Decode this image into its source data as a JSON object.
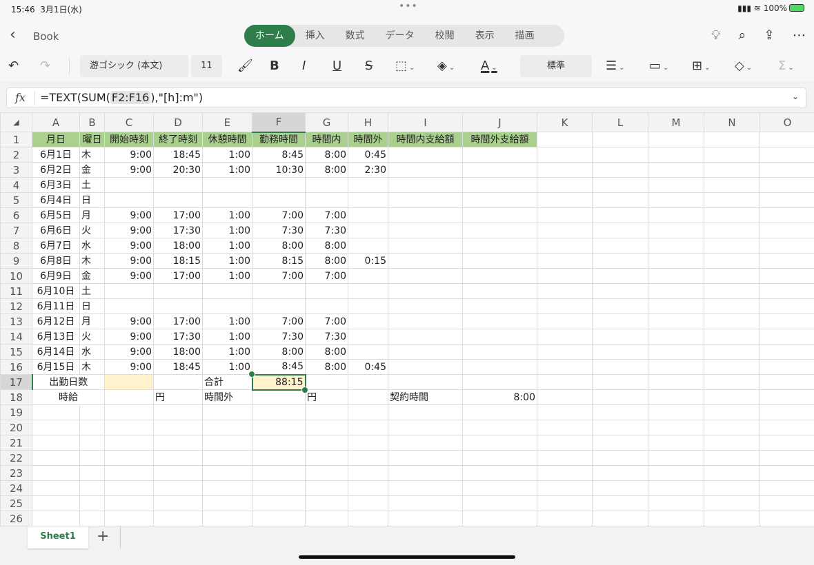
{
  "status": {
    "time": "15:46",
    "date": "3月1日(水)",
    "battery": "100%"
  },
  "nav": {
    "back": "Book",
    "tabs": [
      "ホーム",
      "挿入",
      "数式",
      "データ",
      "校閲",
      "表示",
      "描画"
    ],
    "active_tab": 0
  },
  "toolbar": {
    "font": "游ゴシック (本文)",
    "size": "11",
    "number_format": "標準"
  },
  "formula": {
    "prefix": "=TEXT(SUM(",
    "ref": "F2:F16",
    "suffix": "),\"[h]:m\")"
  },
  "columns": [
    "A",
    "B",
    "C",
    "D",
    "E",
    "F",
    "G",
    "H",
    "I",
    "J",
    "K",
    "L",
    "M",
    "N",
    "O"
  ],
  "selected": {
    "col": "F",
    "row": 17
  },
  "colors": {
    "accent": "#2e7d4a",
    "header_fill": "#a9d08e",
    "input_fill": "#fff2cc"
  },
  "rows": [
    [
      "月日",
      "曜日",
      "開始時刻",
      "終了時刻",
      "休憩時間",
      "勤務時間",
      "時間内",
      "時間外",
      "時間内支給額",
      "時間外支給額"
    ],
    [
      "6月1日",
      "木",
      "9:00",
      "18:45",
      "1:00",
      "8:45",
      "8:00",
      "0:45",
      "",
      ""
    ],
    [
      "6月2日",
      "金",
      "9:00",
      "20:30",
      "1:00",
      "10:30",
      "8:00",
      "2:30",
      "",
      ""
    ],
    [
      "6月3日",
      "土",
      "",
      "",
      "",
      "",
      "",
      "",
      "",
      ""
    ],
    [
      "6月4日",
      "日",
      "",
      "",
      "",
      "",
      "",
      "",
      "",
      ""
    ],
    [
      "6月5日",
      "月",
      "9:00",
      "17:00",
      "1:00",
      "7:00",
      "7:00",
      "",
      "",
      ""
    ],
    [
      "6月6日",
      "火",
      "9:00",
      "17:30",
      "1:00",
      "7:30",
      "7:30",
      "",
      "",
      ""
    ],
    [
      "6月7日",
      "水",
      "9:00",
      "18:00",
      "1:00",
      "8:00",
      "8:00",
      "",
      "",
      ""
    ],
    [
      "6月8日",
      "木",
      "9:00",
      "18:15",
      "1:00",
      "8:15",
      "8:00",
      "0:15",
      "",
      ""
    ],
    [
      "6月9日",
      "金",
      "9:00",
      "17:00",
      "1:00",
      "7:00",
      "7:00",
      "",
      "",
      ""
    ],
    [
      "6月10日",
      "土",
      "",
      "",
      "",
      "",
      "",
      "",
      "",
      ""
    ],
    [
      "6月11日",
      "日",
      "",
      "",
      "",
      "",
      "",
      "",
      "",
      ""
    ],
    [
      "6月12日",
      "月",
      "9:00",
      "17:00",
      "1:00",
      "7:00",
      "7:00",
      "",
      "",
      ""
    ],
    [
      "6月13日",
      "火",
      "9:00",
      "17:30",
      "1:00",
      "7:30",
      "7:30",
      "",
      "",
      ""
    ],
    [
      "6月14日",
      "水",
      "9:00",
      "18:00",
      "1:00",
      "8:00",
      "8:00",
      "",
      "",
      ""
    ],
    [
      "6月15日",
      "木",
      "9:00",
      "18:45",
      "1:00",
      "8:45",
      "8:00",
      "0:45",
      "",
      ""
    ],
    [
      "出勤日数",
      "",
      "",
      "",
      "合計",
      "88:15",
      "",
      "",
      "",
      ""
    ],
    [
      "時給",
      "",
      "",
      "円",
      "時間外",
      "",
      "円",
      "",
      "契約時間",
      "8:00"
    ]
  ],
  "total_rows": 26,
  "sheets": [
    "Sheet1"
  ]
}
